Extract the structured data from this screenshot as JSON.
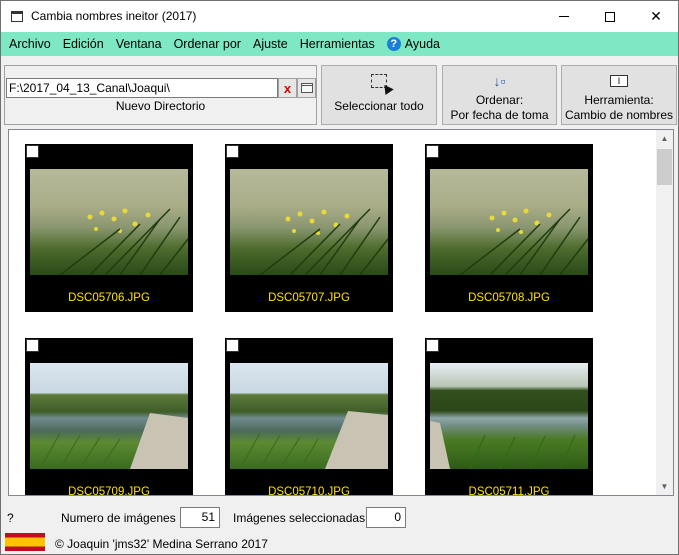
{
  "window": {
    "title": "Cambia nombres ineitor (2017)",
    "controls": {
      "minimize": "—",
      "maximize": "☐",
      "close": "✕"
    }
  },
  "menu": {
    "items": [
      "Archivo",
      "Edición",
      "Ventana",
      "Ordenar por",
      "Ajuste",
      "Herramientas"
    ],
    "help_icon": "?",
    "help_label": "Ayuda"
  },
  "directory": {
    "value": "F:\\2017_04_13_Canal\\Joaqui\\",
    "clear_icon": "x",
    "label": "Nuevo Directorio"
  },
  "toolbar": {
    "select_all": {
      "label": "Seleccionar todo"
    },
    "order": {
      "line1": "Ordenar:",
      "line2": "Por fecha de toma",
      "icon": "↓▫"
    },
    "tool": {
      "line1": "Herramienta:",
      "line2": "Cambio de nombres",
      "icon": "I"
    }
  },
  "gallery": {
    "scroll_position": 0.0,
    "items": [
      {
        "filename": "DSC05706.JPG",
        "checked": false,
        "photo": "iris"
      },
      {
        "filename": "DSC05707.JPG",
        "checked": false,
        "photo": "iris"
      },
      {
        "filename": "DSC05708.JPG",
        "checked": false,
        "photo": "iris"
      },
      {
        "filename": "DSC05709.JPG",
        "checked": false,
        "photo": "canal"
      },
      {
        "filename": "DSC05710.JPG",
        "checked": false,
        "photo": "canal"
      },
      {
        "filename": "DSC05711.JPG",
        "checked": false,
        "photo": "canal-b"
      }
    ]
  },
  "status": {
    "help": "?",
    "count_label": "Numero de imágenes",
    "count": "51",
    "selected_label": "Imágenes seleccionadas",
    "selected": "0"
  },
  "footer": {
    "flag": "spain-flag",
    "copyright": "© Joaquin 'jms32' Medina Serrano 2017"
  },
  "colors": {
    "menu_bg": "#7ee8c5",
    "filename": "#ffe400",
    "help_icon": "#1c7fd6"
  }
}
